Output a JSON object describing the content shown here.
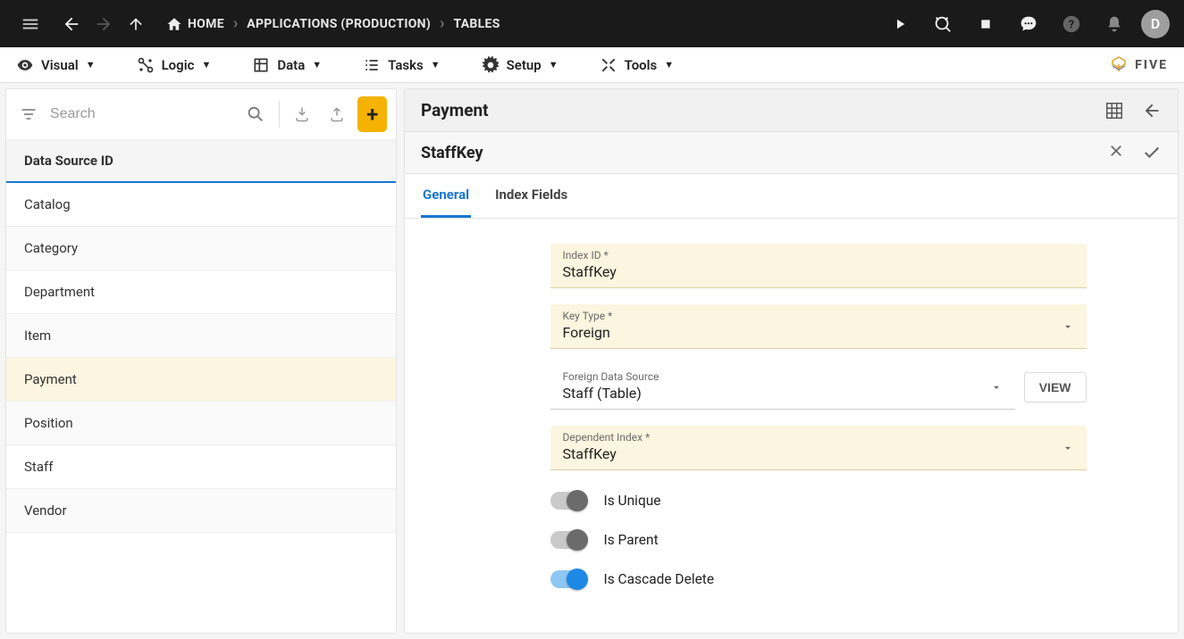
{
  "breadcrumbs": {
    "home": "HOME",
    "apps": "APPLICATIONS (PRODUCTION)",
    "tables": "TABLES"
  },
  "avatar_initial": "D",
  "menus": {
    "visual": "Visual",
    "logic": "Logic",
    "data": "Data",
    "tasks": "Tasks",
    "setup": "Setup",
    "tools": "Tools"
  },
  "logo_text": "FIVE",
  "left_panel": {
    "search_placeholder": "Search",
    "header": "Data Source ID",
    "items": [
      {
        "label": "Catalog"
      },
      {
        "label": "Category"
      },
      {
        "label": "Department"
      },
      {
        "label": "Item"
      },
      {
        "label": "Payment",
        "selected": true
      },
      {
        "label": "Position"
      },
      {
        "label": "Staff"
      },
      {
        "label": "Vendor"
      }
    ]
  },
  "detail": {
    "title": "Payment",
    "subtitle": "StaffKey",
    "tabs": {
      "general": "General",
      "index_fields": "Index Fields"
    },
    "fields": {
      "index_id": {
        "label": "Index ID *",
        "value": "StaffKey"
      },
      "key_type": {
        "label": "Key Type *",
        "value": "Foreign"
      },
      "foreign_ds": {
        "label": "Foreign Data Source",
        "value": "Staff (Table)"
      },
      "dependent": {
        "label": "Dependent Index *",
        "value": "StaffKey"
      }
    },
    "view_button": "VIEW",
    "toggles": {
      "is_unique": {
        "label": "Is Unique",
        "on": false
      },
      "is_parent": {
        "label": "Is Parent",
        "on": false
      },
      "is_cascade": {
        "label": "Is Cascade Delete",
        "on": true
      }
    }
  }
}
